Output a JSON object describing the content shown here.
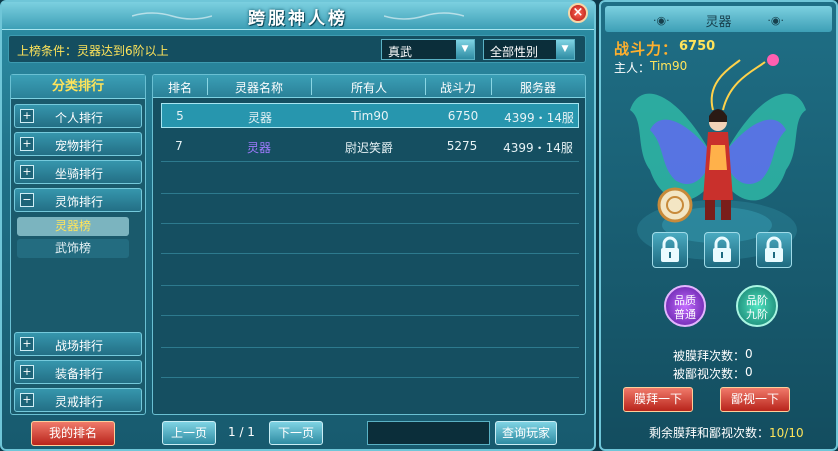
{
  "window": {
    "title": "跨服神人榜",
    "close_label": "×"
  },
  "condition": {
    "text": "上榜条件：灵器达到6阶以上",
    "filter_job": "真武",
    "filter_gender": "全部性别"
  },
  "categories": {
    "header": "分类排行",
    "items": [
      {
        "label": "个人排行",
        "icon": "+"
      },
      {
        "label": "宠物排行",
        "icon": "+"
      },
      {
        "label": "坐骑排行",
        "icon": "+"
      },
      {
        "label": "灵饰排行",
        "icon": "−"
      },
      {
        "label": "战场排行",
        "icon": "+"
      },
      {
        "label": "装备排行",
        "icon": "+"
      },
      {
        "label": "灵戒排行",
        "icon": "+"
      }
    ],
    "sub_items": [
      {
        "label": "灵器榜",
        "active": true
      },
      {
        "label": "武饰榜",
        "active": false
      }
    ],
    "my_rank_label": "我的排名"
  },
  "table": {
    "columns": [
      "排名",
      "灵器名称",
      "所有人",
      "战斗力",
      "服务器"
    ],
    "rows": [
      {
        "rank": "5",
        "name": "灵器",
        "owner": "Tim90",
        "power": "6750",
        "server": "4399・14服"
      },
      {
        "rank": "7",
        "name": "灵器",
        "owner": "尉迟笑爵",
        "power": "5275",
        "server": "4399・14服"
      }
    ]
  },
  "pager": {
    "prev_label": "上一页",
    "page": "1 / 1",
    "next_label": "下一页",
    "search_value": "",
    "query_label": "查询玩家"
  },
  "detail": {
    "title": "灵器",
    "power_label": "战斗力：",
    "power_value": "6750",
    "owner_label": "主人：",
    "owner_value": "Tim90",
    "quality_orb": "品质普通",
    "quality_orb_line1": "品质",
    "quality_orb_line2": "普通",
    "tier_orb_line1": "品阶",
    "tier_orb_line2": "九阶",
    "worship_label": "被膜拜次数：",
    "worship_value": "0",
    "despise_label": "被鄙视次数：",
    "despise_value": "0",
    "worship_btn": "膜拜一下",
    "despise_btn": "鄙视一下",
    "remain_label": "剩余膜拜和鄙视次数：",
    "remain_value": "10/10"
  },
  "colors": {
    "accent_yellow": "#ffe45a",
    "power_orange": "#ffb02e",
    "panel_teal": "#1f6f86",
    "red_button": "#b8241b",
    "purple_name": "#a07bff"
  },
  "icons": [
    "close-icon",
    "plus-icon",
    "minus-icon",
    "dropdown-arrow-icon",
    "lock-icon"
  ]
}
